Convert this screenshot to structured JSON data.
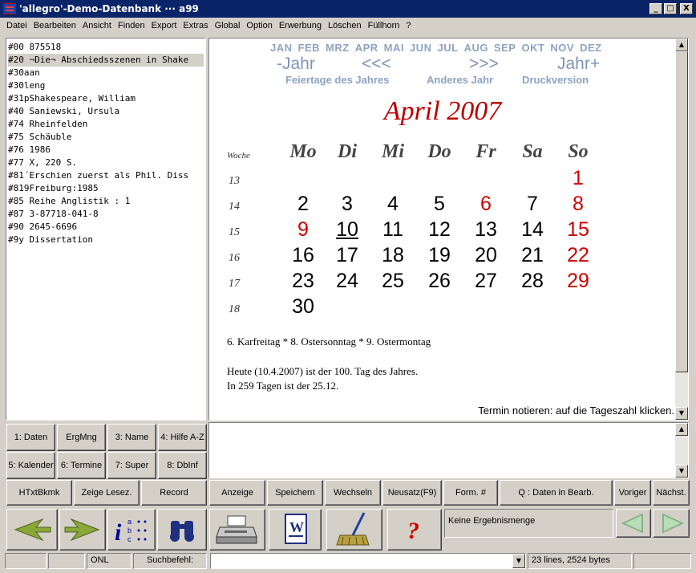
{
  "title": "'allegro'-Demo-Datenbank ··· a99",
  "window_buttons": {
    "minimize": "_",
    "maximize": "□",
    "close": "X"
  },
  "menu": [
    "Datei",
    "Bearbeiten",
    "Ansicht",
    "Finden",
    "Export",
    "Extras",
    "Global",
    "Option",
    "Erwerbung",
    "Löschen",
    "Füllhorn",
    "?"
  ],
  "record": [
    "#00 875518",
    "#20 ¬Die¬ Abschiedsszenen in Shake",
    "#30aan",
    "#30leng",
    "#31pShakespeare, William",
    "#40 Saniewski, Ursula",
    "#74 Rheinfelden",
    "#75 Schäuble",
    "#76 1986",
    "#77 X, 220 S.",
    "#81´Erschien zuerst als Phil. Diss",
    "#819Freiburg:1985",
    "#85 Reihe Anglistik : 1",
    "#87 3-87718-041-8",
    "#90 2645-6696",
    "#9y Dissertation"
  ],
  "calendar": {
    "months": [
      "JAN",
      "FEB",
      "MRZ",
      "APR",
      "MAI",
      "JUN",
      "JUL",
      "AUG",
      "SEP",
      "OKT",
      "NOV",
      "DEZ"
    ],
    "prev_year": "-Jahr",
    "prev": "<<<",
    "next": ">>>",
    "next_year": "Jahr+",
    "links": [
      "Feiertage des Jahres",
      "Anderes Jahr",
      "Druckversion"
    ],
    "title": "April  2007",
    "week_label": "Woche",
    "weekdays": [
      "Mo",
      "Di",
      "Mi",
      "Do",
      "Fr",
      "Sa",
      "So"
    ],
    "weeks": [
      {
        "wk": "13",
        "days": [
          "",
          "",
          "",
          "",
          "",
          "",
          "1"
        ]
      },
      {
        "wk": "14",
        "days": [
          "2",
          "3",
          "4",
          "5",
          "6",
          "7",
          "8"
        ]
      },
      {
        "wk": "15",
        "days": [
          "9",
          "10",
          "11",
          "12",
          "13",
          "14",
          "15"
        ]
      },
      {
        "wk": "16",
        "days": [
          "16",
          "17",
          "18",
          "19",
          "20",
          "21",
          "22"
        ]
      },
      {
        "wk": "17",
        "days": [
          "23",
          "24",
          "25",
          "26",
          "27",
          "28",
          "29"
        ]
      },
      {
        "wk": "18",
        "days": [
          "30",
          "",
          "",
          "",
          "",
          "",
          ""
        ]
      }
    ],
    "red_days": [
      "1",
      "6",
      "8",
      "9",
      "15",
      "22",
      "29"
    ],
    "today": "10",
    "holidays": "6. Karfreitag * 8. Ostersonntag * 9. Ostermontag",
    "today_line1": "Heute (10.4.2007) ist der 100. Tag des Jahres.",
    "today_line2": "In 259 Tagen ist der 25.12.",
    "hint": "Termin notieren: auf die Tageszahl klicken."
  },
  "left_buttons": [
    [
      "1: Daten",
      "ErgMng",
      "3: Name",
      "4: Hilfe A-Z"
    ],
    [
      "5: Kalender",
      "6: Termine",
      "7: Super",
      "8: DbInf"
    ],
    [
      "HTxtBkmk",
      "Zeige Lesez.",
      "Record"
    ]
  ],
  "mid_buttons": [
    "Anzeige",
    "Speichern",
    "Wechseln",
    "Neusatz(F9)",
    "Form. #",
    "Q : Daten in Bearb.",
    "Voriger",
    "Nächst."
  ],
  "result_text": "Keine Ergebnismenge",
  "status": {
    "mode": "ONL",
    "search_label": "Suchbefehl:",
    "search_value": "",
    "info": "23 lines, 2524 bytes"
  }
}
